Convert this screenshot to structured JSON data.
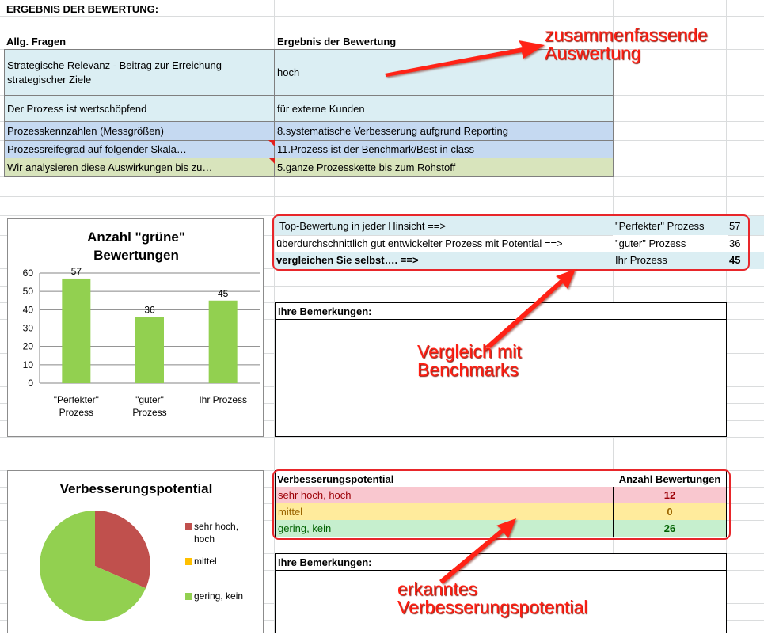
{
  "sheet": {
    "title": "ERGEBNIS DER BEWERTUNG:",
    "col_header_questions": "Allg. Fragen",
    "col_header_result": "Ergebnis der Bewertung",
    "rows": [
      {
        "question": "Strategische Relevanz - Beitrag zur Erreichung strategischer Ziele",
        "answer": "hoch"
      },
      {
        "question": "Der Prozess ist wertschöpfend",
        "answer": "für externe Kunden"
      },
      {
        "question": "Prozesskennzahlen (Messgrößen)",
        "answer": "8.systematische Verbesserung aufgrund Reporting"
      },
      {
        "question": "Prozessreifegrad auf folgender Skala…",
        "answer": "11.Prozess ist der Benchmark/Best in class"
      },
      {
        "question": "Wir analysieren diese Auswirkungen bis zu…",
        "answer": "5.ganze Prozesskette bis zum Rohstoff"
      }
    ]
  },
  "benchmark_table": {
    "rows": [
      {
        "desc": "Top-Bewertung in jeder Hinsicht ==>",
        "label": "\"Perfekter\" Prozess",
        "value": "57"
      },
      {
        "desc": "überdurchschnittlich gut entwickelter Prozess mit Potential ==>",
        "label": "\"guter\" Prozess",
        "value": "36"
      },
      {
        "desc": "vergleichen Sie selbst…. ==>",
        "label": "Ihr Prozess",
        "value": "45"
      }
    ]
  },
  "remarks1": {
    "title": "Ihre Bemerkungen:"
  },
  "remarks2": {
    "title": "Ihre Bemerkungen:"
  },
  "improvement_table": {
    "header_label": "Verbesserungspotential",
    "header_count": "Anzahl Bewertungen",
    "rows": [
      {
        "label": "sehr hoch, hoch",
        "count": "12",
        "bg": "#f9c7cf",
        "color": "#9c0006"
      },
      {
        "label": "mittel",
        "count": "0",
        "bg": "#ffeb9c",
        "color": "#9c6500"
      },
      {
        "label": "gering, kein",
        "count": "26",
        "bg": "#c6efce",
        "color": "#006100"
      }
    ]
  },
  "annotations": {
    "top": "zusammenfassende Auswertung",
    "middle": "Vergleich mit Benchmarks",
    "bottom": "erkanntes Verbesserungspotential"
  },
  "chart_data": [
    {
      "type": "bar",
      "title": "Anzahl \"grüne\" Bewertungen",
      "categories": [
        "\"Perfekter\" Prozess",
        "\"guter\" Prozess",
        "Ihr Prozess"
      ],
      "values": [
        57,
        36,
        45
      ],
      "ylim": [
        0,
        60
      ],
      "yticks": [
        0,
        10,
        20,
        30,
        40,
        50,
        60
      ],
      "color": "#92d050",
      "grid": true
    },
    {
      "type": "pie",
      "title": "Verbesserungspotential",
      "labels": [
        "sehr hoch, hoch",
        "mittel",
        "gering, kein"
      ],
      "values": [
        12,
        0,
        26
      ],
      "colors": [
        "#c0504d",
        "#ffc000",
        "#92d050"
      ],
      "legend": "right"
    }
  ]
}
